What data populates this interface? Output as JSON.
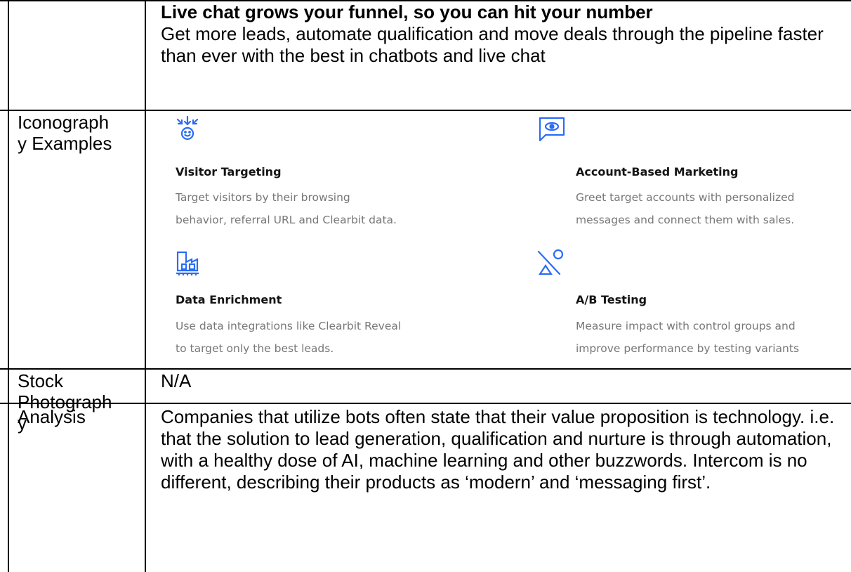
{
  "hero": {
    "title": "Live chat grows your funnel, so you can hit your number",
    "subtitle": "Get more leads, automate qualification and move deals through the pipeline faster than ever with the best in chatbots and live chat"
  },
  "rows": {
    "iconography_label": "Iconograph\ny Examples",
    "stock_label": "Stock\nPhotograph\ny",
    "stock_value": "N/A",
    "analysis_label": "Analysis",
    "analysis_text": "Companies that utilize bots often state that their value proposition is technology. i.e. that the solution to lead generation, qualification and nurture is through automation, with a healthy dose of AI, machine learning and other buzzwords. Intercom is no different, describing their products as ‘modern’ and ‘messaging first’."
  },
  "features": [
    {
      "icon": "visitor-targeting-icon",
      "title": "Visitor Targeting",
      "desc": "Target visitors by their browsing\nbehavior, referral URL and Clearbit data."
    },
    {
      "icon": "account-based-marketing-icon",
      "title": "Account-Based Marketing",
      "desc": "Greet target accounts with personalized\nmessages and connect them with sales."
    },
    {
      "icon": "data-enrichment-icon",
      "title": "Data Enrichment",
      "desc": "Use data integrations like Clearbit Reveal\nto target only the best leads."
    },
    {
      "icon": "ab-testing-icon",
      "title": "A/B Testing",
      "desc": "Measure impact with control groups and\nimprove performance by testing variants"
    }
  ],
  "colors": {
    "icon_blue": "#2a6cf6",
    "desc_gray": "#777777",
    "border": "#000000"
  }
}
